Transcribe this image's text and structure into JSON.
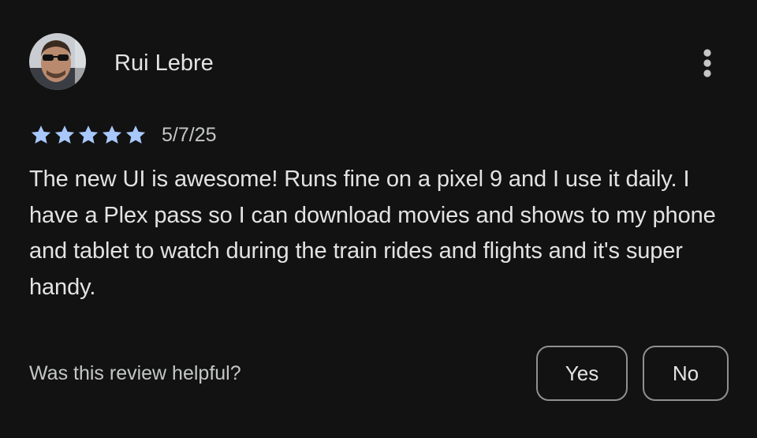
{
  "review": {
    "reviewer_name": "Rui Lebre",
    "avatar_icon": "reviewer-photo",
    "more_icon": "more-vert-icon",
    "rating": 5,
    "rating_max": 5,
    "star_color": "#a8c7fa",
    "date": "5/7/25",
    "text": "The new UI is awesome! Runs fine on a pixel 9 and I use it daily. I have a Plex pass so I can download movies and shows to my phone and tablet to watch during the train rides and flights and it's super handy."
  },
  "helpful": {
    "question": "Was this review helpful?",
    "yes_label": "Yes",
    "no_label": "No"
  }
}
